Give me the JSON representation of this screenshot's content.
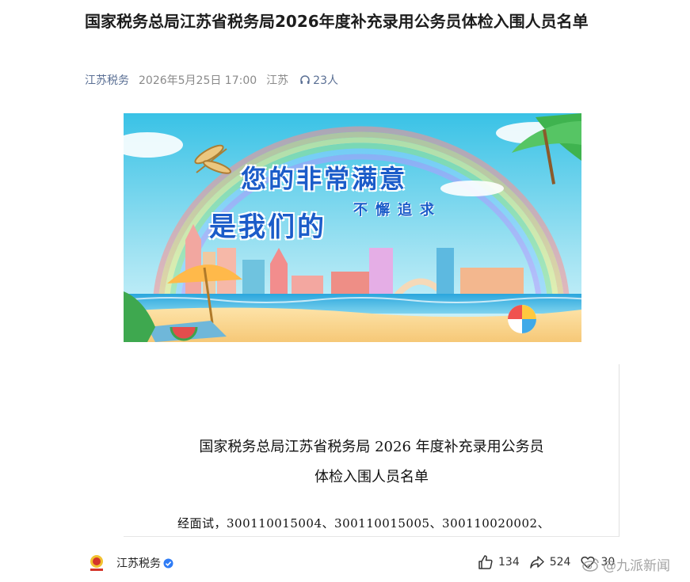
{
  "article": {
    "title": "国家税务总局江苏省税务局2026年度补充录用公务员体检入围人员名单",
    "author": "江苏税务",
    "date": "2026年5月25日 17:00",
    "location": "江苏",
    "listeners": "23人"
  },
  "banner": {
    "line1": "您的非常满意",
    "line2": "是我们的",
    "line3": "不懈追求"
  },
  "document": {
    "title_line1": "国家税务总局江苏省税务局 2026 年度补充录用公务员",
    "title_line2": "体检入围人员名单",
    "body_line1": "经面试，300110015004、300110015005、300110020002、"
  },
  "footer": {
    "account_name": "江苏税务",
    "likes": "134",
    "shares": "524",
    "favorites": "30"
  },
  "watermark": {
    "text": "@九派新闻"
  },
  "colors": {
    "author_link": "#5a6f94",
    "banner_text": "#1b5cc9",
    "verified_badge": "#2f7cf6"
  }
}
